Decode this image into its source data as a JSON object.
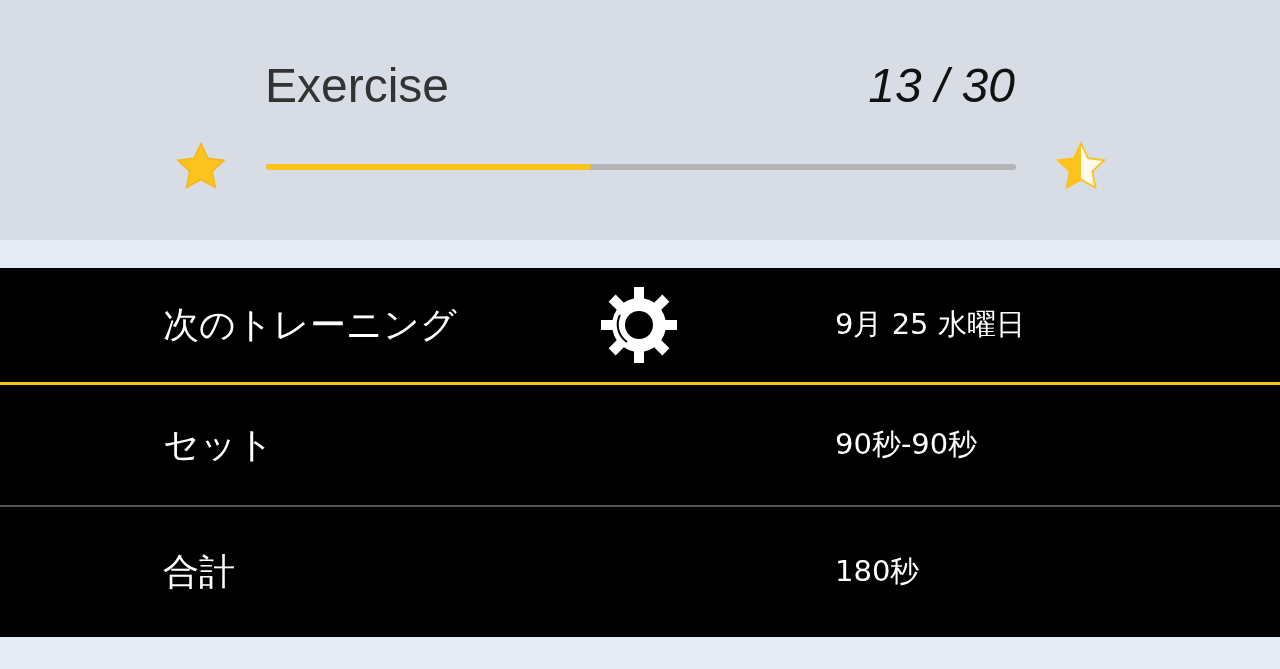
{
  "header": {
    "title": "Exercise",
    "count": "13 / 30",
    "progress": {
      "level": 0.433
    }
  },
  "rows": [
    {
      "kind": "settings",
      "label": "次のトレーニング",
      "value": "9月 25 水曜日"
    },
    {
      "kind": "plain",
      "label": "セット",
      "value": "90秒-90秒"
    },
    {
      "kind": "plain",
      "label": "合計",
      "value": "180秒"
    }
  ]
}
